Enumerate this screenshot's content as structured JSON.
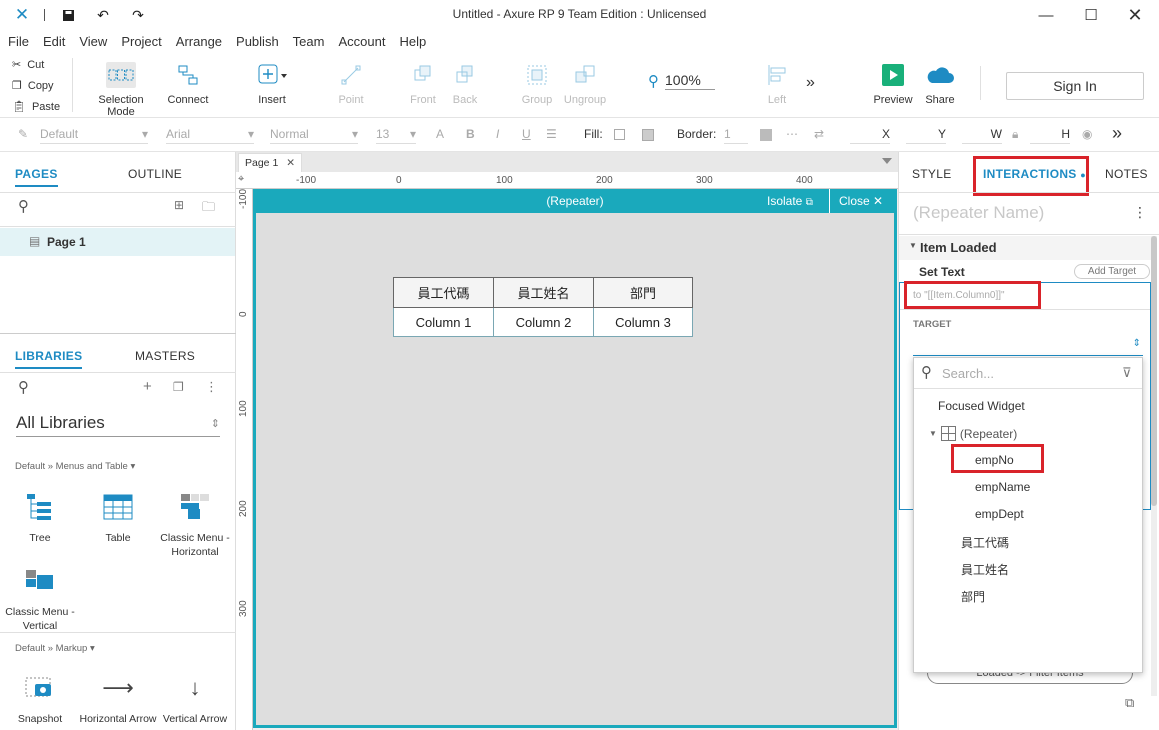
{
  "window": {
    "title": "Untitled - Axure RP 9 Team Edition : Unlicensed"
  },
  "menu": [
    "File",
    "Edit",
    "View",
    "Project",
    "Arrange",
    "Publish",
    "Team",
    "Account",
    "Help"
  ],
  "clipboard": {
    "cut": "Cut",
    "copy": "Copy",
    "paste": "Paste"
  },
  "toolbar": {
    "selection_mode": "Selection Mode",
    "connect": "Connect",
    "insert": "Insert",
    "point": "Point",
    "front": "Front",
    "back": "Back",
    "group": "Group",
    "ungroup": "Ungroup",
    "zoom": "100%",
    "left": "Left",
    "preview": "Preview",
    "share": "Share",
    "sign_in": "Sign In"
  },
  "stylebar": {
    "style": "Default",
    "font": "Arial",
    "weight": "Normal",
    "size": "13",
    "fill": "Fill:",
    "border": "Border:",
    "border_value": "1",
    "x": "X",
    "y": "Y",
    "w": "W",
    "h": "H"
  },
  "left_panel": {
    "tabs": {
      "pages": "PAGES",
      "outline": "OUTLINE"
    },
    "page": "Page 1",
    "lib_tabs": {
      "libraries": "LIBRARIES",
      "masters": "MASTERS"
    },
    "all_libraries": "All Libraries",
    "section_menus": "Default » Menus and Table ▾",
    "section_markup": "Default » Markup ▾",
    "items_menus": [
      "Tree",
      "Table",
      "Classic Menu - Horizontal",
      "Classic Menu - Vertical"
    ],
    "items_markup": [
      "Snapshot",
      "Horizontal Arrow",
      "Vertical Arrow"
    ]
  },
  "canvas": {
    "tab": "Page 1",
    "ruler_x": [
      "-100",
      "0",
      "100",
      "200",
      "300",
      "400"
    ],
    "ruler_y": [
      "-100",
      "0",
      "100",
      "200",
      "300"
    ],
    "repeater_title": "(Repeater)",
    "isolate": "Isolate",
    "close": "Close",
    "table_headers": [
      "員工代碼",
      "員工姓名",
      "部門"
    ],
    "table_row": [
      "Column 1",
      "Column 2",
      "Column 3"
    ]
  },
  "right_panel": {
    "tabs": {
      "style": "STYLE",
      "interactions": "INTERACTIONS",
      "notes": "NOTES"
    },
    "repeater_name": "(Repeater Name)",
    "event": "Item Loaded",
    "action": "Set Text",
    "add_target": "Add Target",
    "text_value": "to \"[[Item.Column0]]\"",
    "target_label": "TARGET",
    "search_placeholder": "Search...",
    "dropdown_items": {
      "focused": "Focused Widget",
      "repeater": "(Repeater)",
      "empNo": "empNo",
      "empName": "empName",
      "empDept": "empDept",
      "h1": "員工代碼",
      "h2": "員工姓名",
      "h3": "部門"
    },
    "hidden_button": "Loaded -> Filter Items"
  },
  "colors": {
    "accent": "#1e8bc3",
    "teal": "#1aa9bc",
    "highlight": "#d9232a",
    "preview_green": "#19b07a"
  }
}
